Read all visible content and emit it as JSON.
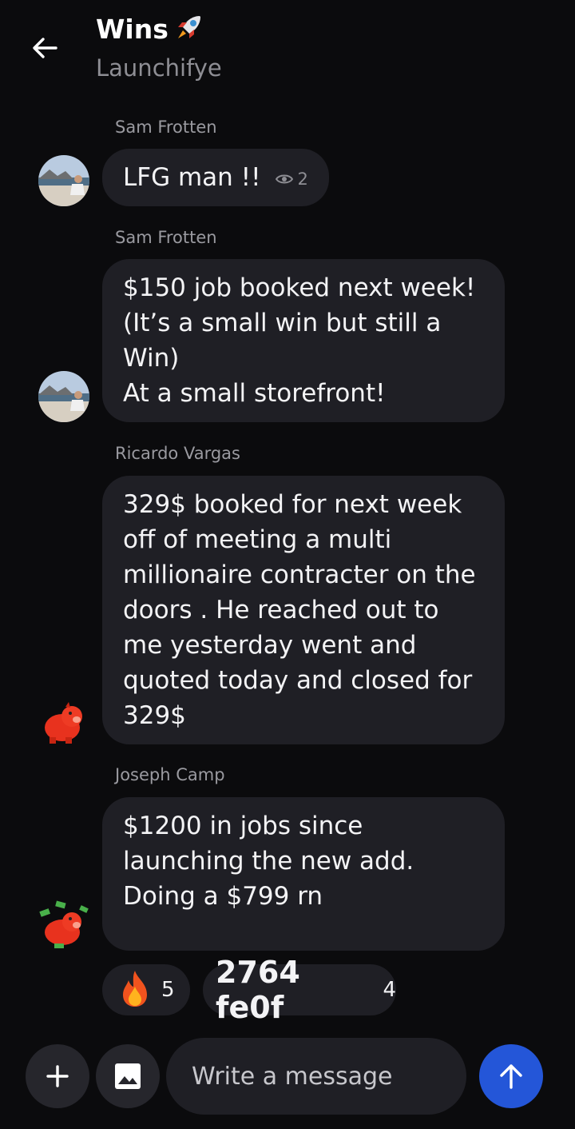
{
  "header": {
    "title": "Wins",
    "title_emoji": "rocket-icon",
    "subtitle": "Launchifye"
  },
  "messages": [
    {
      "sender": "Sam Frotten",
      "lines": [
        "LFG man !!"
      ],
      "seen_count": "2",
      "avatar": "beach-photo-avatar"
    },
    {
      "sender": "Sam Frotten",
      "lines": [
        "$150 job booked next week!",
        "(It’s a small win but still a",
        "Win)",
        "At a small storefront!"
      ],
      "avatar": "beach-photo-avatar"
    },
    {
      "sender": "Ricardo Vargas",
      "lines": [
        "329$ booked for next week",
        "off of meeting a multi",
        "millionaire contracter on the",
        "doors . He reached out to",
        "me yesterday went and",
        "quoted today and closed for",
        "329$"
      ],
      "avatar": "red-pig-avatar"
    },
    {
      "sender": "Joseph Camp",
      "lines": [
        "$1200 in jobs since",
        "launching the new add.",
        "Doing a $799 rn"
      ],
      "avatar": "red-pig-money-avatar"
    }
  ],
  "reactions": [
    {
      "emoji": "fire-icon",
      "count": "5"
    },
    {
      "label": "2764 fe0f",
      "count": "4"
    }
  ],
  "composer": {
    "placeholder": "Write a message"
  },
  "colors": {
    "background": "#0b0b0d",
    "bubble": "#1f1f25",
    "send_button": "#2456d8"
  }
}
